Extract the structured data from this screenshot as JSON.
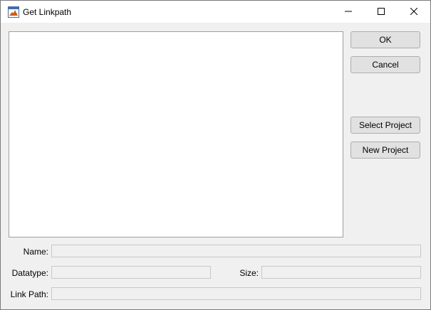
{
  "window": {
    "title": "Get Linkpath",
    "icon": "matlab-icon",
    "controls": {
      "minimize": "minimize-icon",
      "maximize": "maximize-icon",
      "close": "close-icon"
    }
  },
  "list": {
    "items": []
  },
  "buttons": {
    "ok": "OK",
    "cancel": "Cancel",
    "select_project": "Select Project",
    "new_project": "New Project"
  },
  "fields": {
    "name": {
      "label": "Name:",
      "value": ""
    },
    "datatype": {
      "label": "Datatype:",
      "value": ""
    },
    "size": {
      "label": "Size:",
      "value": ""
    },
    "link_path": {
      "label": "Link Path:",
      "value": ""
    }
  },
  "colors": {
    "background": "#f0f0f0",
    "titlebar": "#ffffff",
    "button_face": "#e1e1e1",
    "button_border": "#adadad"
  }
}
